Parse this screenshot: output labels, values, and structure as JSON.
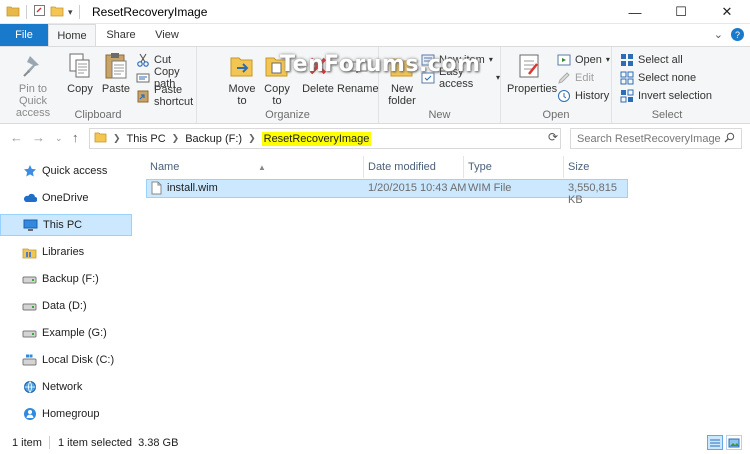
{
  "window": {
    "title": "ResetRecoveryImage",
    "controls": [
      "—",
      "☐",
      "✕"
    ]
  },
  "ribbon_tabs": {
    "file": "File",
    "home": "Home",
    "share": "Share",
    "view": "View"
  },
  "ribbon": {
    "clipboard": {
      "label": "Clipboard",
      "pin": "Pin to Quick access",
      "copy": "Copy",
      "paste": "Paste",
      "cut": "Cut",
      "copy_path": "Copy path",
      "paste_shortcut": "Paste shortcut"
    },
    "organize": {
      "label": "Organize",
      "move_to": "Move to",
      "copy_to": "Copy to",
      "delete": "Delete",
      "rename": "Rename"
    },
    "new": {
      "label": "New",
      "new_folder": "New folder",
      "new_item": "New item",
      "easy_access": "Easy access"
    },
    "open": {
      "label": "Open",
      "properties": "Properties",
      "open": "Open",
      "edit": "Edit",
      "history": "History"
    },
    "select": {
      "label": "Select",
      "select_all": "Select all",
      "select_none": "Select none",
      "invert_selection": "Invert selection"
    }
  },
  "watermark": "TenForums.com",
  "address": {
    "crumbs": [
      "This PC",
      "Backup (F:)",
      "ResetRecoveryImage"
    ],
    "search_placeholder": "Search ResetRecoveryImage"
  },
  "nav_pane": {
    "items": [
      {
        "label": "Quick access",
        "icon": "star-icon"
      },
      {
        "label": "OneDrive",
        "icon": "cloud-icon"
      },
      {
        "label": "This PC",
        "icon": "computer-icon",
        "selected": true
      },
      {
        "label": "Libraries",
        "icon": "libraries-icon"
      },
      {
        "label": "Backup (F:)",
        "icon": "drive-icon"
      },
      {
        "label": "Data (D:)",
        "icon": "drive-icon"
      },
      {
        "label": "Example (G:)",
        "icon": "drive-icon"
      },
      {
        "label": "Local Disk (C:)",
        "icon": "windows-drive-icon"
      },
      {
        "label": "Network",
        "icon": "network-icon"
      },
      {
        "label": "Homegroup",
        "icon": "homegroup-icon"
      }
    ]
  },
  "file_list": {
    "columns": [
      "Name",
      "Date modified",
      "Type",
      "Size"
    ],
    "rows": [
      {
        "name": "install.wim",
        "date": "1/20/2015 10:43 AM",
        "type": "WIM File",
        "size": "3,550,815 KB"
      }
    ]
  },
  "status": {
    "items": "1 item",
    "selected": "1 item selected  3.38 GB"
  },
  "colors": {
    "file_tab": "#1979ca",
    "selection": "#cce8ff",
    "highlight": "#ffff00"
  }
}
